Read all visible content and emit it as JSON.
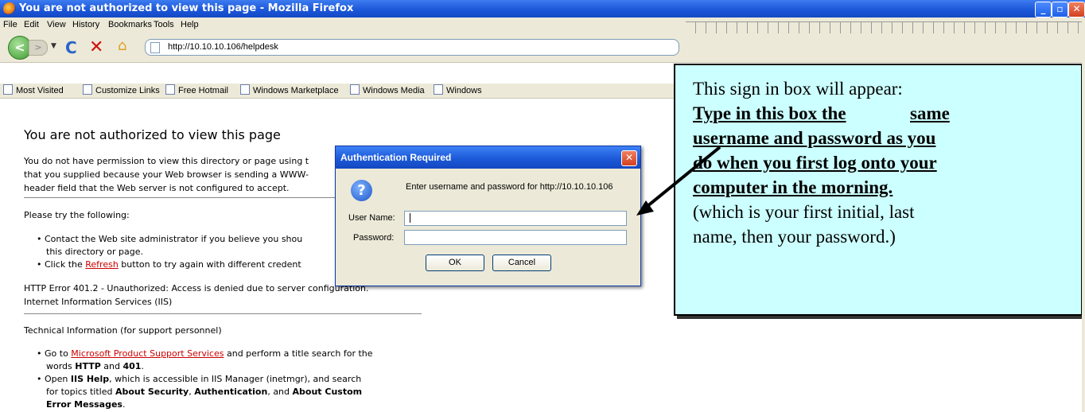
{
  "window": {
    "title": "You are not authorized to view this page - Mozilla Firefox",
    "minimize": "_",
    "maximize": "▫",
    "close": "✕"
  },
  "menu": [
    "File",
    "Edit",
    "View",
    "History",
    "Bookmarks",
    "Tools",
    "Help"
  ],
  "toolbar": {
    "back": "<",
    "forward": ">",
    "reload": "C",
    "stop": "✕",
    "home": "⌂",
    "url": "http://10.10.10.106/helpdesk"
  },
  "bookmarks": [
    "Most Visited",
    "Customize Links",
    "Free Hotmail",
    "Windows Marketplace",
    "Windows Media",
    "Windows"
  ],
  "page": {
    "heading": "You are not authorized to view this page",
    "intro_1": "You do not have permission to view this directory or page using t",
    "intro_2": "that you supplied because your Web browser is sending a WWW-",
    "intro_3": "header field that the Web server is not configured to accept.",
    "try": "Please try the following:",
    "b1a": "Contact the Web site administrator if you believe you shou",
    "b1b": "this directory or page.",
    "b2_pre": "Click the ",
    "b2_link": "Refresh",
    "b2_post": " button to try again with different credent",
    "error_1": "HTTP Error 401.2 - Unauthorized: Access is denied due to server configuration.",
    "error_2": "Internet Information Services (IIS)",
    "tech": "Technical Information (for support personnel)",
    "t1_pre": "Go to ",
    "t1_link": "Microsoft Product Support Services",
    "t1_post": " and perform a title search for the",
    "t1b_pre": "words ",
    "t1b_http": "HTTP",
    "t1b_and": " and ",
    "t1b_401": "401",
    "t1b_end": ".",
    "t2_pre": "Open ",
    "t2_iis": "IIS Help",
    "t2_post": ", which is accessible in IIS Manager (inetmgr), and search",
    "t2b_pre": "for topics titled ",
    "t2b_sec": "About Security",
    "t2b_comma": ", ",
    "t2b_auth": "Authentication",
    "t2b_and": ", and ",
    "t2b_custom": "About Custom",
    "t2c_err": "Error Messages",
    "t2c_end": "."
  },
  "dialog": {
    "title": "Authentication Required",
    "close": "✕",
    "icon": "?",
    "message": "Enter username and password for http://10.10.10.106",
    "username_label": "User Name:",
    "password_label": "Password:",
    "username_value": "",
    "password_value": "",
    "ok": "OK",
    "cancel": "Cancel"
  },
  "callout": {
    "line1": "This sign in box will appear:",
    "line2a": "Type in this box the",
    "line2b": "same",
    "line3": "username and password as you",
    "line4": "do when you first log onto your",
    "line5": "computer in the morning.",
    "line6": "(which is your first initial, last",
    "line7": "name, then your password.)"
  }
}
